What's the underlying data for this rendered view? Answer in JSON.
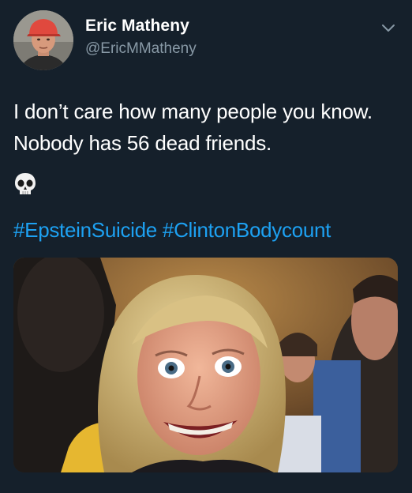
{
  "author": {
    "display_name": "Eric Matheny",
    "handle": "@EricMMatheny"
  },
  "icons": {
    "avatar": "avatar-photo",
    "menu": "chevron-down-icon",
    "emoji": "skull-emoji"
  },
  "tweet": {
    "text": "I don’t care how many people you know. Nobody has 56 dead friends.",
    "hashtags": [
      "#EpsteinSuicide",
      "#ClintonBodycount"
    ]
  },
  "colors": {
    "background": "#15202b",
    "name": "#ffffff",
    "handle": "#8899a6",
    "link": "#1da1f2"
  }
}
